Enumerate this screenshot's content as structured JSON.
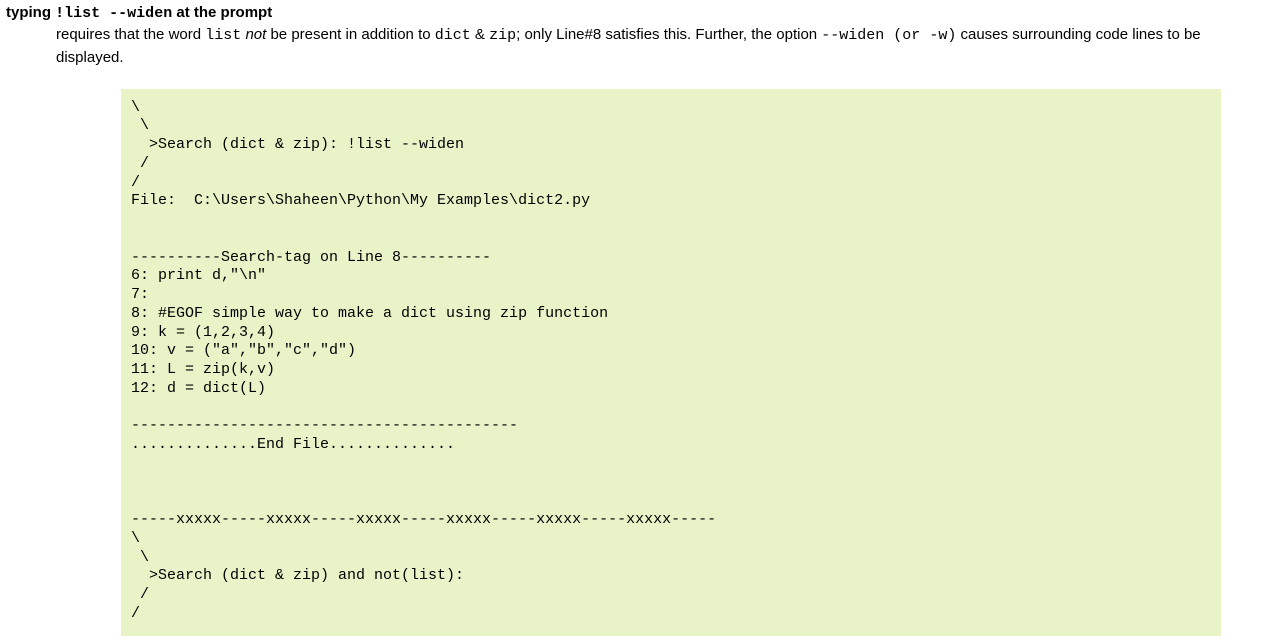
{
  "heading": {
    "prefix": "typing ",
    "command": "!list --widen",
    "suffix": " at the prompt"
  },
  "desc": {
    "t1": "requires that the word ",
    "code1": "list",
    "t2": " ",
    "ital": "not",
    "t3": " be present in addition to ",
    "code2": "dict",
    "t4": " & ",
    "code3": "zip",
    "t5": "; only Line#8 satisfies this. Further, the option ",
    "code4": "--widen (or -w)",
    "t6": " causes surrounding code lines to be displayed."
  },
  "code": "\\\n \\\n  >Search (dict & zip): !list --widen\n /\n/\nFile:  C:\\Users\\Shaheen\\Python\\My Examples\\dict2.py\n\n\n----------Search-tag on Line 8----------\n6: print d,\"\\n\"\n7:\n8: #EGOF simple way to make a dict using zip function\n9: k = (1,2,3,4)\n10: v = (\"a\",\"b\",\"c\",\"d\")\n11: L = zip(k,v)\n12: d = dict(L)\n\n-------------------------------------------\n..............End File..............\n\n\n\n-----xxxxx-----xxxxx-----xxxxx-----xxxxx-----xxxxx-----xxxxx-----\n\\\n \\\n  >Search (dict & zip) and not(list):\n /\n/"
}
